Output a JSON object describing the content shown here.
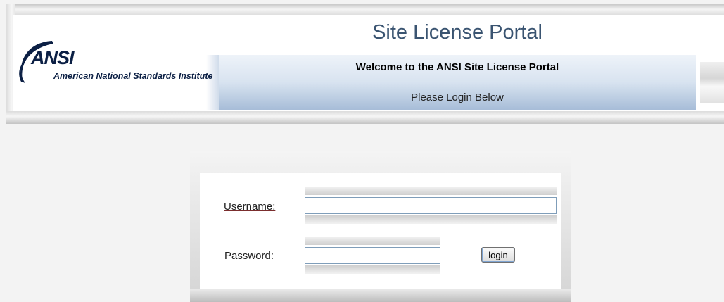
{
  "header": {
    "logo": {
      "acronym": "ANSI",
      "org_name": "American National Standards Institute"
    },
    "title": "Site License Portal",
    "welcome": "Welcome to the ANSI Site License Portal",
    "prompt": "Please Login Below"
  },
  "login": {
    "username_label": "Username:",
    "username_value": "",
    "password_label": "Password:",
    "password_value": "",
    "button_label": "login"
  },
  "colors": {
    "title_text": "#3a5471",
    "logo_navy": "#0b1f44",
    "banner_blue": "#a7bdd8",
    "input_border": "#7f9db9"
  }
}
